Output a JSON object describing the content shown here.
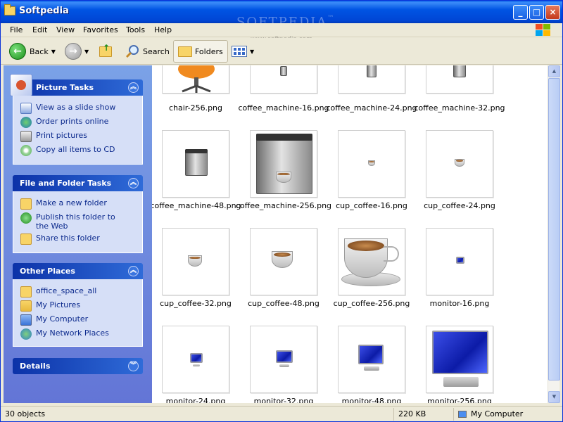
{
  "window": {
    "title": "Softpedia",
    "watermark": "SOFTPEDIA",
    "watermark_mark": "™",
    "watermark_url": "www.softpedia.com"
  },
  "menu": [
    "File",
    "Edit",
    "View",
    "Favorites",
    "Tools",
    "Help"
  ],
  "toolbar": {
    "back_label": "Back",
    "search_label": "Search",
    "folders_label": "Folders"
  },
  "taskpane": {
    "picture_tasks": {
      "title": "Picture Tasks",
      "items": [
        "View as a slide show",
        "Order prints online",
        "Print pictures",
        "Copy all items to CD"
      ]
    },
    "file_folder_tasks": {
      "title": "File and Folder Tasks",
      "items": [
        "Make a new folder",
        "Publish this folder to the Web",
        "Share this folder"
      ]
    },
    "other_places": {
      "title": "Other Places",
      "items": [
        "office_space_all",
        "My Pictures",
        "My Computer",
        "My Network Places"
      ]
    },
    "details": {
      "title": "Details"
    }
  },
  "files": [
    "chair-256.png",
    "coffee_machine-16.png",
    "coffee_machine-24.png",
    "coffee_machine-32.png",
    "coffee_machine-48.png",
    "coffee_machine-256.png",
    "cup_coffee-16.png",
    "cup_coffee-24.png",
    "cup_coffee-32.png",
    "cup_coffee-48.png",
    "cup_coffee-256.png",
    "monitor-16.png",
    "monitor-24.png",
    "monitor-32.png",
    "monitor-48.png",
    "monitor-256.png"
  ],
  "status": {
    "objects": "30 objects",
    "size": "220 KB",
    "location": "My Computer"
  },
  "colors": {
    "title_bar": "#0054e3",
    "task_pane": "#6375d6",
    "link": "#0c2a8d"
  }
}
